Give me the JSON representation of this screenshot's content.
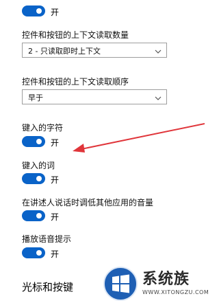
{
  "settings": {
    "toggle_top": {
      "state_label": "开",
      "on": true
    },
    "read_amount": {
      "label": "控件和按钮的上下文读取数量",
      "selected": "2 - 只读取即时上下文"
    },
    "read_order": {
      "label": "控件和按钮的上下文读取顺序",
      "selected": "早于"
    },
    "typed_chars": {
      "label": "键入的字符",
      "state_label": "开",
      "on": true
    },
    "typed_words": {
      "label": "键入的词",
      "state_label": "开",
      "on": true
    },
    "lower_volume": {
      "label": "在讲述人说话时调低其他应用的音量",
      "state_label": "开",
      "on": true
    },
    "audio_cues": {
      "label": "播放语音提示",
      "state_label": "开",
      "on": true
    },
    "section_heading": "光标和按键"
  },
  "annotation": {
    "arrow_color": "#e0353a"
  },
  "watermark": {
    "text": "系统族",
    "url": "WWW.XITONGZU.COM"
  },
  "colors": {
    "toggle_on": "#0a63c8",
    "border": "#9d9d9d"
  }
}
